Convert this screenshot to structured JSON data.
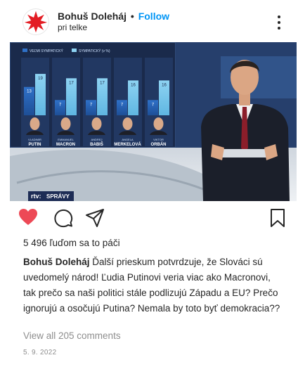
{
  "post": {
    "author": "Bohuš Doleháj",
    "separator": "•",
    "follow_label": "Follow",
    "location": "pri telke",
    "likes_text": "5 496 ľuďom sa to páči",
    "caption_author": "Bohuš Doleháj",
    "caption_text": "Ďalší prieskum potvrdzuje, že Slováci sú uvedomelý národ! Ľudia Putinovi veria viac ako Macronovi, tak prečo sa naši politici stále podlizujú Západu a EU? Prečo ignorujú a osočujú Putina? Nemala by toto byť demokracia??",
    "comments_link": "View all 205 comments",
    "date": "5. 9. 2022"
  },
  "tv": {
    "legend_very": "VEĽMI SYMPATICKÝ",
    "legend_rather": "SYMPATICKÝ (v %)",
    "logo": "rtv:",
    "news": "SPRÁVY",
    "people": [
      {
        "first": "VLADIMIR",
        "last": "PUTIN",
        "very": 13,
        "rather": 19
      },
      {
        "first": "EMMANUEL",
        "last": "MACRON",
        "very": 7,
        "rather": 17
      },
      {
        "first": "ANDREJ",
        "last": "BABIŠ",
        "very": 7,
        "rather": 17
      },
      {
        "first": "ANGELA",
        "last": "MERKELOVÁ",
        "very": 7,
        "rather": 16
      },
      {
        "first": "VIKTOR",
        "last": "ORBÁN",
        "very": 7,
        "rather": 16
      }
    ]
  },
  "colors": {
    "accent_blue": "#0095f6",
    "heart_red": "#ed4956",
    "text": "#262626",
    "muted": "#8e8e8e"
  },
  "icons": [
    "app-logo-icon",
    "more-options-icon",
    "heart-icon",
    "comment-icon",
    "share-icon",
    "bookmark-icon"
  ]
}
